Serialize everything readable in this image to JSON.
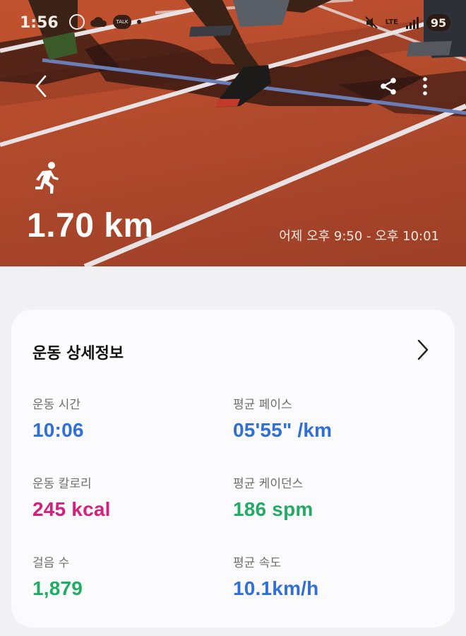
{
  "status_bar": {
    "time": "1:56",
    "network": "LTE",
    "battery": "95"
  },
  "hero": {
    "distance": "1.70 km",
    "time_range": "어제 오후 9:50 - 오후 10:01",
    "icons": {
      "back": "chevron-left-icon",
      "share": "share-icon",
      "more": "more-vertical-icon",
      "activity": "running-icon"
    }
  },
  "details": {
    "title": "운동 상세정보",
    "metrics": [
      {
        "label": "운동 시간",
        "value": "10:06",
        "color": "#2f6fd6"
      },
      {
        "label": "평균 페이스",
        "value": "05'55\" /km",
        "color": "#2f6fd6"
      },
      {
        "label": "운동 칼로리",
        "value": "245 kcal",
        "color": "#d3207c"
      },
      {
        "label": "평균 케이던스",
        "value": "186 spm",
        "color": "#20ad63"
      },
      {
        "label": "걸음 수",
        "value": "1,879",
        "color": "#20ad63"
      },
      {
        "label": "평균 속도",
        "value": "10.1km/h",
        "color": "#2f6fd6"
      }
    ]
  }
}
